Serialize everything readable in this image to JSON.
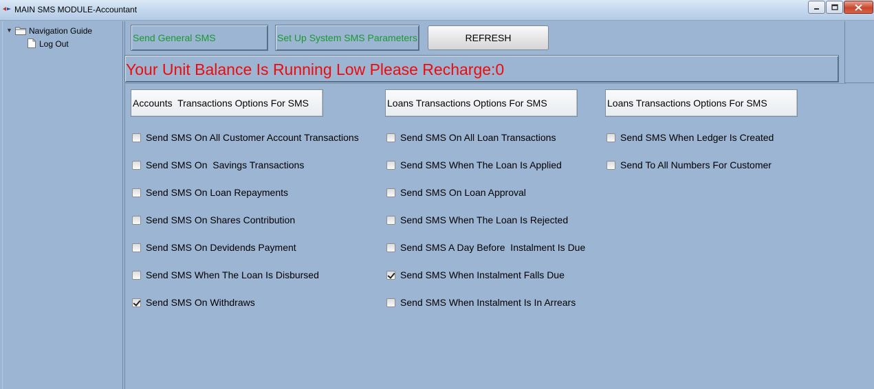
{
  "window": {
    "title": "MAIN SMS MODULE-Accountant",
    "minimize_icon": "minimize-icon",
    "maximize_icon": "maximize-icon",
    "close_icon": "close-icon"
  },
  "nav": {
    "root_label": "Navigation Guide",
    "items": [
      {
        "label": "Log Out"
      }
    ]
  },
  "toolbar": {
    "send_general_label": "Send General SMS",
    "setup_params_label": "Set Up System SMS Parameters",
    "refresh_label": "REFRESH"
  },
  "alert": {
    "text": "Your Unit Balance Is Running Low Please Recharge:0",
    "color": "#ee0b0b"
  },
  "sections": [
    {
      "title": "Accounts  Transactions Options For SMS",
      "options": [
        {
          "label": "Send SMS On All Customer Account Transactions",
          "checked": false
        },
        {
          "label": "Send SMS On  Savings Transactions",
          "checked": false
        },
        {
          "label": "Send SMS On Loan Repayments",
          "checked": false
        },
        {
          "label": "Send SMS On Shares Contribution",
          "checked": false
        },
        {
          "label": "Send SMS On Devidends Payment",
          "checked": false
        },
        {
          "label": "Send SMS When The Loan Is Disbursed",
          "checked": false
        },
        {
          "label": "Send SMS On Withdraws",
          "checked": true
        }
      ]
    },
    {
      "title": "Loans Transactions Options For SMS",
      "options": [
        {
          "label": "Send SMS On All Loan Transactions",
          "checked": false
        },
        {
          "label": "Send SMS When The Loan Is Applied",
          "checked": false
        },
        {
          "label": "Send SMS On Loan Approval",
          "checked": false
        },
        {
          "label": "Send SMS When The Loan Is Rejected",
          "checked": false
        },
        {
          "label": "Send SMS A Day Before  Instalment Is Due",
          "checked": false
        },
        {
          "label": "Send SMS When Instalment Falls Due",
          "checked": true
        },
        {
          "label": "Send SMS When Instalment Is In Arrears",
          "checked": false
        }
      ]
    },
    {
      "title": "Loans Transactions Options For SMS",
      "options": [
        {
          "label": "Send SMS When Ledger Is Created",
          "checked": false
        },
        {
          "label": "Send To All Numbers For Customer",
          "checked": false
        }
      ]
    }
  ]
}
